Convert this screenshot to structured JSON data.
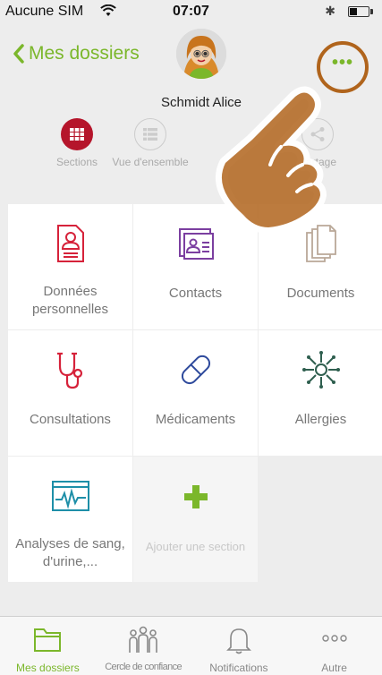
{
  "status_bar": {
    "carrier": "Aucune SIM",
    "time": "07:07"
  },
  "header": {
    "back_label": "Mes dossiers",
    "user_name": "Schmidt Alice",
    "more_label": "•••"
  },
  "view_tabs": [
    {
      "label": "Sections",
      "active": true
    },
    {
      "label": "Vue d'ensemble",
      "active": false
    },
    {
      "label": "Partage",
      "active": false
    }
  ],
  "sections": [
    {
      "label": "Données personnelles",
      "icon": "personal-data-icon",
      "color": "#d6223a"
    },
    {
      "label": "Contacts",
      "icon": "contacts-icon",
      "color": "#7b3fa0"
    },
    {
      "label": "Documents",
      "icon": "documents-icon",
      "color": "#b9a898"
    },
    {
      "label": "Consultations",
      "icon": "stethoscope-icon",
      "color": "#d6223a"
    },
    {
      "label": "Médicaments",
      "icon": "pill-icon",
      "color": "#2e4a9c"
    },
    {
      "label": "Allergies",
      "icon": "allergy-icon",
      "color": "#2f5f4f"
    },
    {
      "label": "Analyses de sang, d'urine,...",
      "icon": "lab-monitor-icon",
      "color": "#1e8fa8"
    }
  ],
  "add_section": {
    "label": "Ajouter une section",
    "icon": "plus-icon",
    "color": "#7bb72b"
  },
  "tabbar": [
    {
      "label": "Mes dossiers",
      "icon": "folder-icon",
      "active": true
    },
    {
      "label": "Cercle de confiance",
      "icon": "people-icon",
      "active": false
    },
    {
      "label": "Notifications",
      "icon": "bell-icon",
      "active": false
    },
    {
      "label": "Autre",
      "icon": "more-icon",
      "active": false
    }
  ],
  "colors": {
    "accent": "#7bb72b",
    "active_tab": "#b5152b",
    "highlight_ring": "#b0641c"
  }
}
